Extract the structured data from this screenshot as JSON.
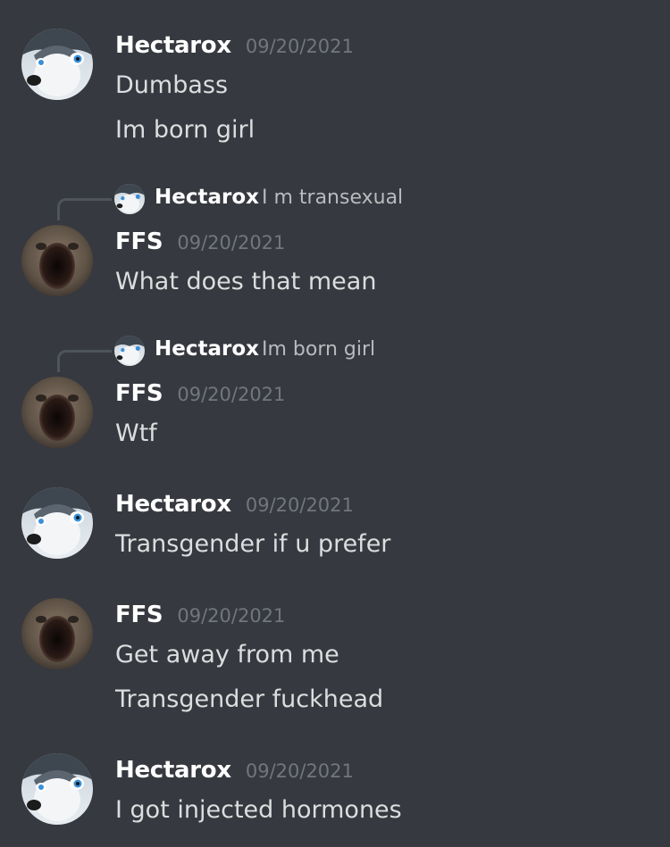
{
  "messages": [
    {
      "author": "Hectarox",
      "timestamp": "09/20/2021",
      "avatar_icon": "husky-avatar-icon",
      "lines": [
        "Dumbass",
        "Im born girl"
      ]
    },
    {
      "reply_to": {
        "author": "Hectarox",
        "text": "I m transexual",
        "avatar_icon": "husky-avatar-icon"
      },
      "author": "FFS",
      "timestamp": "09/20/2021",
      "avatar_icon": "screaming-cat-avatar-icon",
      "lines": [
        "What does that mean"
      ]
    },
    {
      "reply_to": {
        "author": "Hectarox",
        "text": "Im born girl",
        "avatar_icon": "husky-avatar-icon"
      },
      "author": "FFS",
      "timestamp": "09/20/2021",
      "avatar_icon": "screaming-cat-avatar-icon",
      "lines": [
        "Wtf"
      ]
    },
    {
      "author": "Hectarox",
      "timestamp": "09/20/2021",
      "avatar_icon": "husky-avatar-icon",
      "lines": [
        "Transgender if u prefer"
      ]
    },
    {
      "author": "FFS",
      "timestamp": "09/20/2021",
      "avatar_icon": "screaming-cat-avatar-icon",
      "lines": [
        "Get away from me",
        "Transgender fuckhead"
      ]
    },
    {
      "author": "Hectarox",
      "timestamp": "09/20/2021",
      "avatar_icon": "husky-avatar-icon",
      "lines": [
        "I got injected hormones"
      ]
    }
  ],
  "colors": {
    "background": "#36393f",
    "username": "#ffffff",
    "timestamp": "#72767d",
    "message_text": "#dcddde",
    "reply_text": "#b9bbbe",
    "reply_spine": "#4f545c"
  }
}
